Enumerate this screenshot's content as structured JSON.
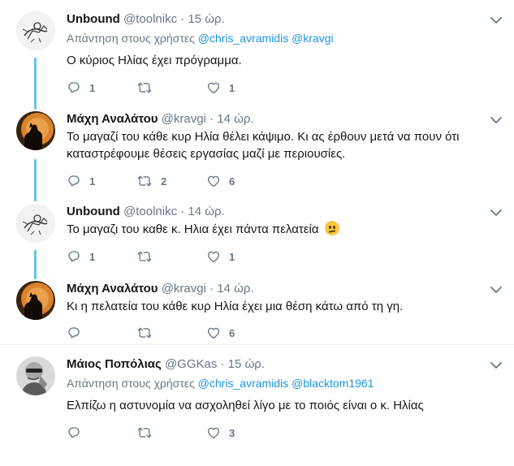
{
  "tweets": [
    {
      "name": "Unbound",
      "handle": "@toolnikc",
      "time": "15 ώρ.",
      "reply_prefix": "Απάντηση στους χρήστες",
      "reply_mentions": [
        "@chris_avramidis",
        "@kravgi"
      ],
      "text": "Ο κύριος Ηλίας έχει πρόγραμμα.",
      "replies": "1",
      "retweets": "",
      "likes": "1"
    },
    {
      "name": "Μάχη Αναλάτου",
      "handle": "@kravgi",
      "time": "14 ώρ.",
      "text_lines": [
        "Το μαγαζί του κάθε κυρ Ηλία θέλει κάψιμο. Κι ας έρθουν μετά να πουν ότι",
        "καταστρέφουμε θέσεις εργασίας μαζί με περιουσίες."
      ],
      "replies": "1",
      "retweets": "2",
      "likes": "6"
    },
    {
      "name": "Unbound",
      "handle": "@toolnikc",
      "time": "14 ώρ.",
      "text": "Το μαγαζι του καθε κ. Ηλια έχει πάντα πελατεία",
      "emoji": "confused-face-emoji",
      "replies": "1",
      "retweets": "",
      "likes": "1"
    },
    {
      "name": "Μάχη Αναλάτου",
      "handle": "@kravgi",
      "time": "14 ώρ.",
      "text": "Κι η πελατεία του κάθε κυρ Ηλία έχει μια θέση κάτω από τη γη.",
      "replies": "",
      "retweets": "",
      "likes": "6"
    },
    {
      "name": "Μάιος Ποπόλιας",
      "handle": "@GGKas",
      "time": "15 ώρ.",
      "reply_prefix": "Απάντηση στους χρήστες",
      "reply_mentions": [
        "@chris_avramidis",
        "@blacktom1961"
      ],
      "text": "Ελπίζω η αστυνομία να ασχοληθεί λίγο με το ποιός είναι ο κ. Ηλίας",
      "replies": "",
      "retweets": "",
      "likes": "3"
    }
  ],
  "dot": "·",
  "colors": {
    "link": "#1b95e0",
    "thread": "#6ac4e8",
    "muted": "#657786"
  },
  "icons": [
    "reply-icon",
    "retweet-icon",
    "like-icon",
    "caret-down-icon"
  ]
}
